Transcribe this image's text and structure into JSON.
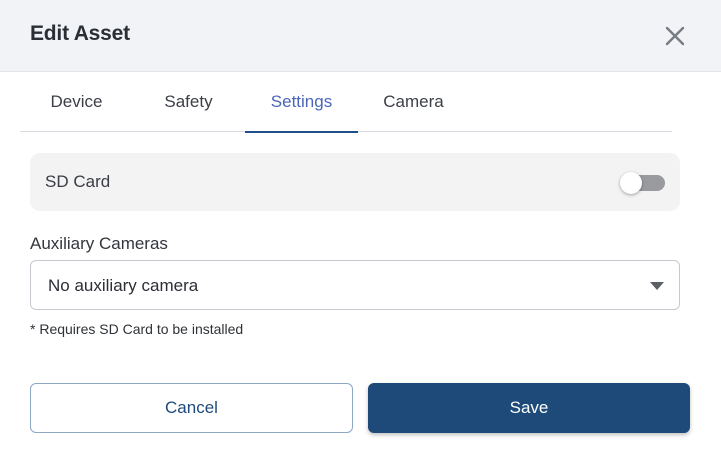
{
  "dialog": {
    "title": "Edit Asset",
    "close_icon": "close-icon"
  },
  "tabs": [
    {
      "label": "Device",
      "active": false
    },
    {
      "label": "Safety",
      "active": false
    },
    {
      "label": "Settings",
      "active": true
    },
    {
      "label": "Camera",
      "active": false
    }
  ],
  "settings": {
    "sd_card": {
      "label": "SD Card",
      "enabled": false
    },
    "auxiliary_cameras": {
      "label": "Auxiliary Cameras",
      "selected": "No auxiliary camera"
    },
    "hint": "* Requires SD Card to be installed"
  },
  "actions": {
    "cancel_label": "Cancel",
    "save_label": "Save"
  },
  "colors": {
    "primary": "#1d4a78",
    "active_tab_text": "#4a66b8",
    "header_bg": "#f2f3f6"
  }
}
